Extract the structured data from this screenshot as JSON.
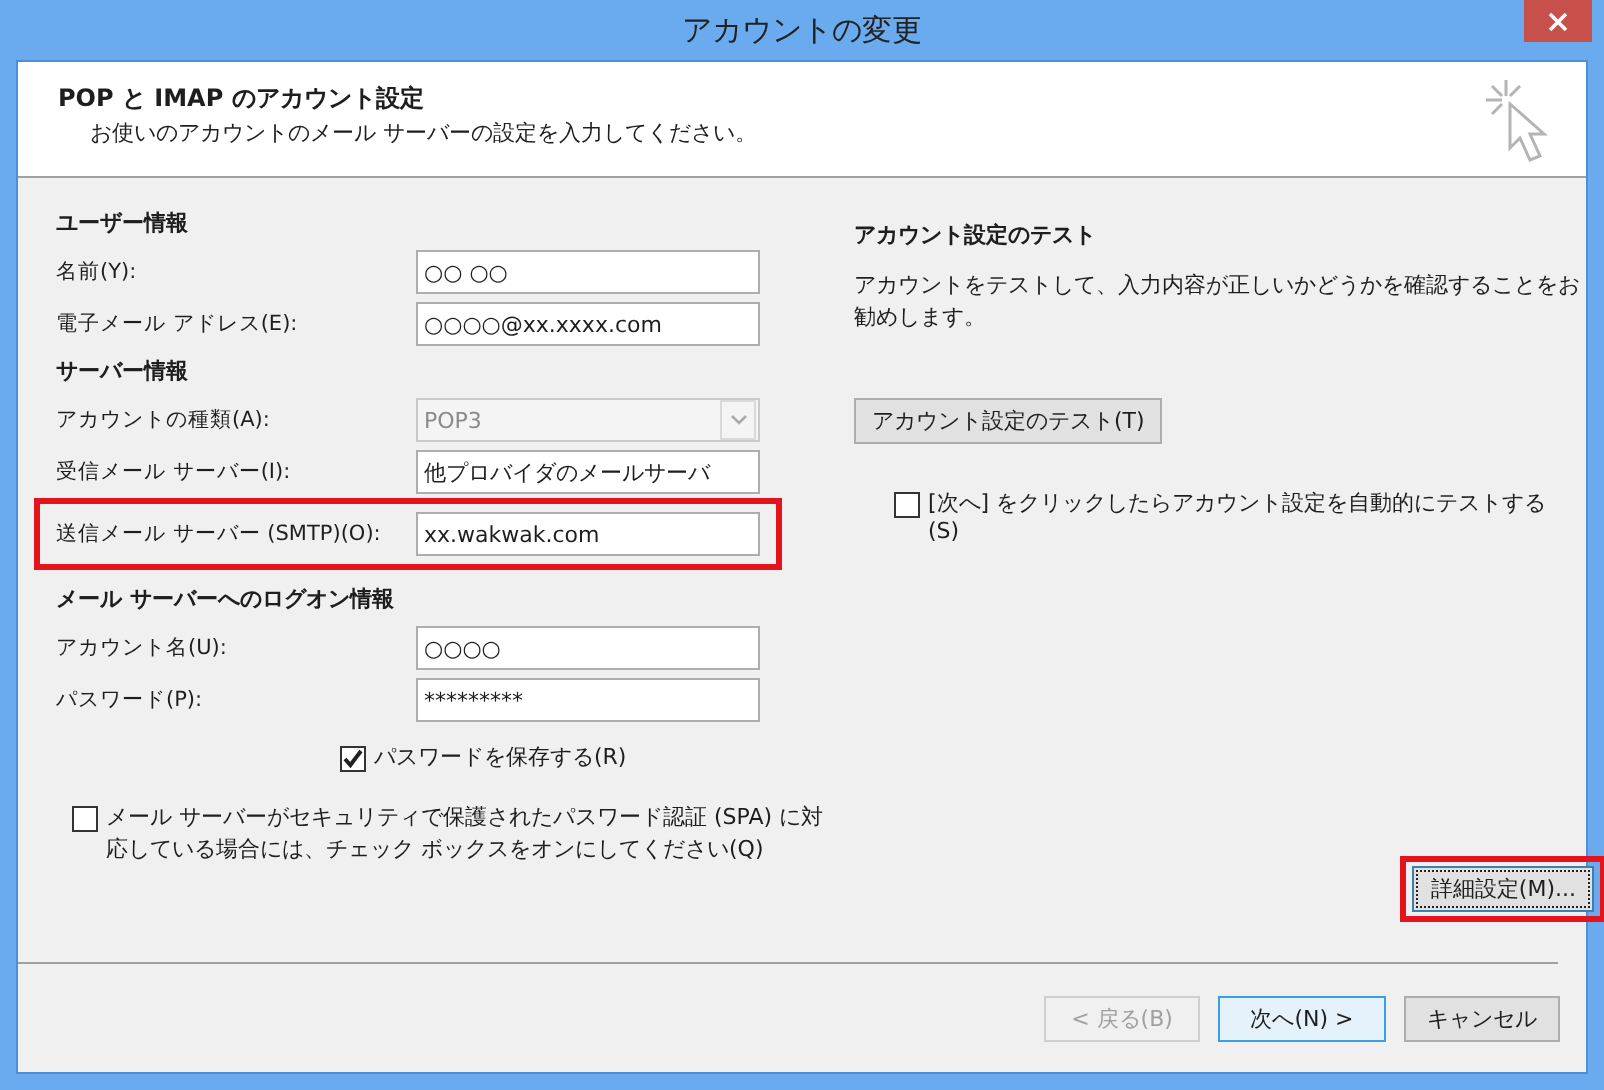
{
  "window": {
    "title": "アカウントの変更"
  },
  "header": {
    "title": "POP と IMAP のアカウント設定",
    "subtitle": "お使いのアカウントのメール サーバーの設定を入力してください。"
  },
  "sections": [
    {
      "title": "ユーザー情報",
      "fields": [
        {
          "kind": "text",
          "label": "名前(Y):",
          "value": "○○ ○○"
        },
        {
          "kind": "text",
          "label": "電子メール アドレス(E):",
          "value": "○○○○@xx.xxxx.com"
        }
      ]
    },
    {
      "title": "サーバー情報",
      "fields": [
        {
          "kind": "select",
          "label": "アカウントの種類(A):",
          "value": "POP3",
          "disabled": true
        },
        {
          "kind": "text",
          "label": "受信メール サーバー(I):",
          "value": "他プロバイダのメールサーバ"
        },
        {
          "kind": "text",
          "label": "送信メール サーバー (SMTP)(O):",
          "value": "xx.wakwak.com",
          "highlighted": true
        }
      ]
    },
    {
      "title": "メール サーバーへのログオン情報",
      "fields": [
        {
          "kind": "text",
          "label": "アカウント名(U):",
          "value": "○○○○"
        },
        {
          "kind": "text",
          "label": "パスワード(P):",
          "value": "*********"
        }
      ]
    }
  ],
  "save_password": {
    "label": "パスワードを保存する(R)",
    "checked": true
  },
  "spa": {
    "label": "メール サーバーがセキュリティで保護されたパスワード認証 (SPA) に対応している場合には、チェック ボックスをオンにしてください(Q)",
    "checked": false
  },
  "test": {
    "title": "アカウント設定のテスト",
    "description": "アカウントをテストして、入力内容が正しいかどうかを確認することをお勧めします。",
    "button": "アカウント設定のテスト(T)",
    "auto_test": {
      "label": "[次へ] をクリックしたらアカウント設定を自動的にテストする(S)",
      "checked": false
    }
  },
  "advanced_button": {
    "label": "詳細設定(M)...",
    "highlighted": true
  },
  "buttons": [
    {
      "label": "< 戻る(B)",
      "disabled": true,
      "default": false
    },
    {
      "label": "次へ(N) >",
      "disabled": false,
      "default": true
    },
    {
      "label": "キャンセル",
      "disabled": false,
      "default": false
    }
  ]
}
